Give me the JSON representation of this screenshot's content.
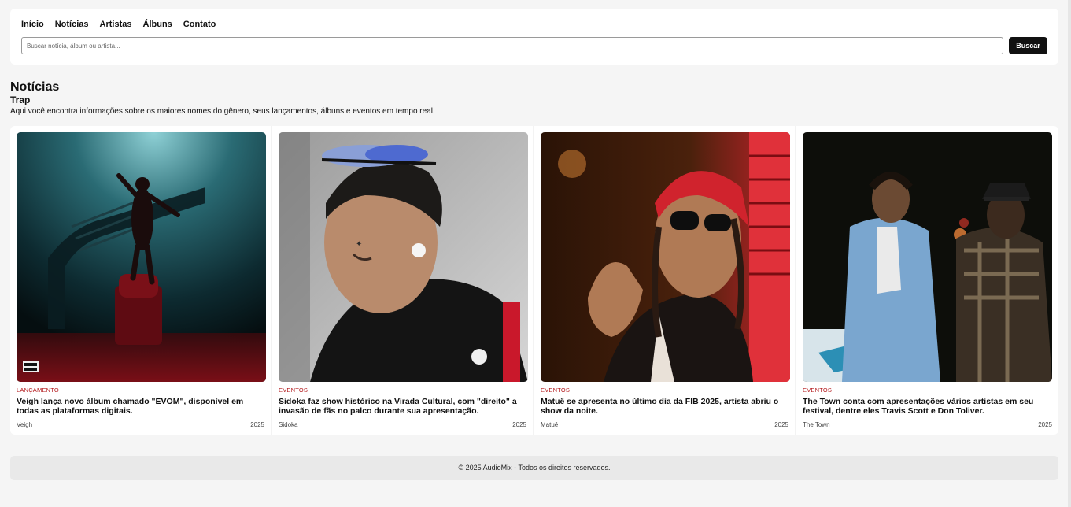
{
  "nav": {
    "items": [
      "Início",
      "Notícias",
      "Artistas",
      "Álbuns",
      "Contato"
    ]
  },
  "search": {
    "placeholder": "Buscar notícia, álbum ou artista...",
    "button_label": "Buscar"
  },
  "section": {
    "title": "Notícias",
    "subtitle": "Trap",
    "description": "Aqui você encontra informações sobre os maiores nomes do gênero, seus lançamentos, álbuns e eventos em tempo real."
  },
  "cards": [
    {
      "category": "LANÇAMENTO",
      "title": "Veigh lança novo álbum chamado \"EVOM\", disponível em todas as plataformas digitais.",
      "artist": "Veigh",
      "year": "2025",
      "image": "album-cover-figure-in-water"
    },
    {
      "category": "EVENTOS",
      "title": "Sidoka faz show histórico na Virada Cultural, com \"direito\" a invasão de fãs no palco durante sua apresentação.",
      "artist": "Sidoka",
      "year": "2025",
      "image": "portrait-sunglasses-on-head"
    },
    {
      "category": "EVENTOS",
      "title": "Matuê se apresenta no último dia da FIB 2025, artista abriu o show da noite.",
      "artist": "Matuê",
      "year": "2025",
      "image": "portrait-red-bandana"
    },
    {
      "category": "EVENTOS",
      "title": "The Town conta com apresentações vários artistas em seu festival, dentre eles Travis Scott e Don Toliver.",
      "artist": "The Town",
      "year": "2025",
      "image": "two-artists-photo"
    }
  ],
  "footer": {
    "text": "© 2025 AudioMix - Todos os direitos reservados."
  },
  "colors": {
    "accent": "#b3181b",
    "button": "#111111",
    "background": "#f5f5f5"
  }
}
